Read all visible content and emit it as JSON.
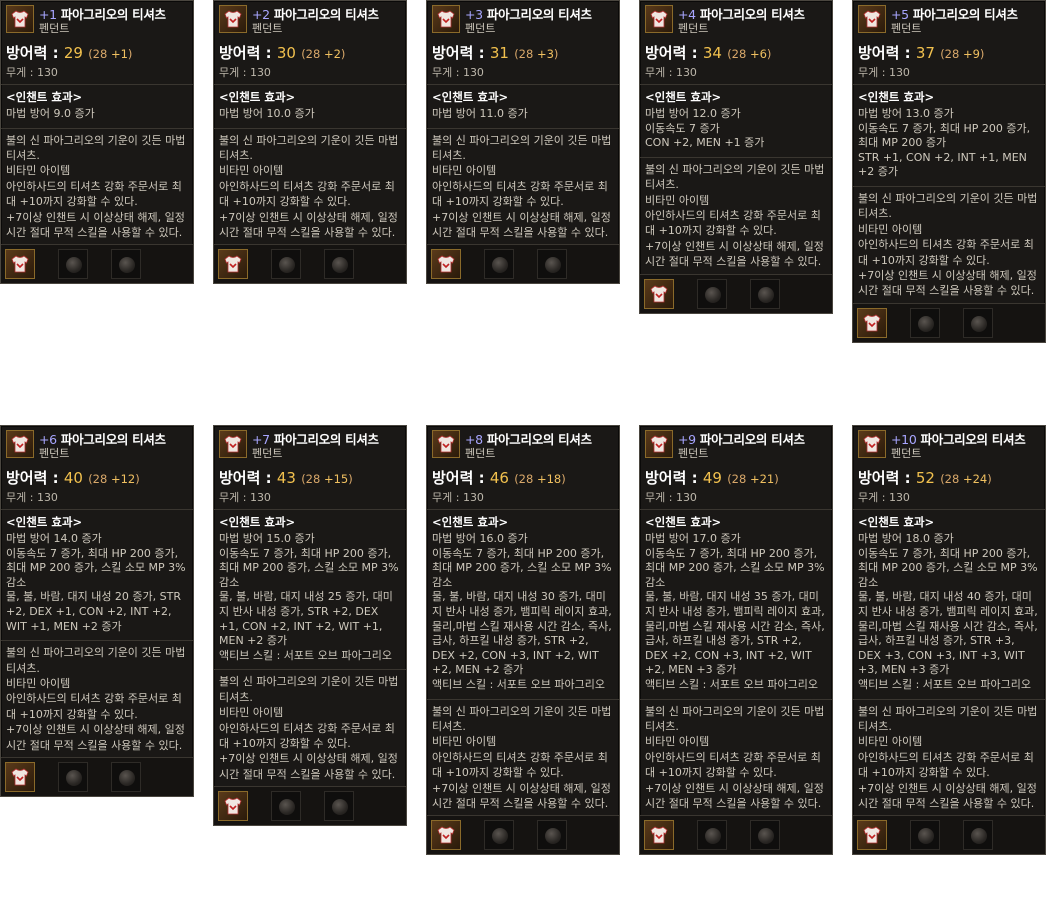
{
  "tooltips": [
    {
      "level": "+1",
      "name": "파아그리오의 티셔츠",
      "type": "펜던트",
      "def_label": "방어력 :",
      "def": "29",
      "def_breakdown_open": "(28",
      "def_bonus": "+1",
      "def_breakdown_close": ")",
      "weight": "무게 : 130",
      "enchant_title": "<인챈트 효과>",
      "effects": "마법 방어 9.0 증가",
      "desc": "불의 신 파아그리오의 기운이 깃든 마법 티셔츠.\n비타민 아이템\n아인하사드의 티셔츠 강화 주문서로 최대 +10까지 강화할 수 있다.\n+7이상 인챈트 시 이상상태 해제, 일정 시간 절대 무적 스킬을 사용할 수 있다."
    },
    {
      "level": "+2",
      "name": "파아그리오의 티셔츠",
      "type": "펜던트",
      "def_label": "방어력 :",
      "def": "30",
      "def_breakdown_open": "(28",
      "def_bonus": "+2",
      "def_breakdown_close": ")",
      "weight": "무게 : 130",
      "enchant_title": "<인챈트 효과>",
      "effects": "마법 방어 10.0 증가",
      "desc": "불의 신 파아그리오의 기운이 깃든 마법 티셔츠.\n비타민 아이템\n아인하사드의 티셔츠 강화 주문서로 최대 +10까지 강화할 수 있다.\n+7이상 인챈트 시 이상상태 해제, 일정 시간 절대 무적 스킬을 사용할 수 있다."
    },
    {
      "level": "+3",
      "name": "파아그리오의 티셔츠",
      "type": "펜던트",
      "def_label": "방어력 :",
      "def": "31",
      "def_breakdown_open": "(28",
      "def_bonus": "+3",
      "def_breakdown_close": ")",
      "weight": "무게 : 130",
      "enchant_title": "<인챈트 효과>",
      "effects": "마법 방어 11.0 증가",
      "desc": "불의 신 파아그리오의 기운이 깃든 마법 티셔츠.\n비타민 아이템\n아인하사드의 티셔츠 강화 주문서로 최대 +10까지 강화할 수 있다.\n+7이상 인챈트 시 이상상태 해제, 일정 시간 절대 무적 스킬을 사용할 수 있다."
    },
    {
      "level": "+4",
      "name": "파아그리오의 티셔츠",
      "type": "펜던트",
      "def_label": "방어력 :",
      "def": "34",
      "def_breakdown_open": "(28",
      "def_bonus": "+6",
      "def_breakdown_close": ")",
      "weight": "무게 : 130",
      "enchant_title": "<인챈트 효과>",
      "effects": "마법 방어 12.0 증가\n이동속도 7 증가\nCON +2, MEN +1 증가",
      "desc": "불의 신 파아그리오의 기운이 깃든 마법 티셔츠.\n비타민 아이템\n아인하사드의 티셔츠 강화 주문서로 최대 +10까지 강화할 수 있다.\n+7이상 인챈트 시 이상상태 해제, 일정 시간 절대 무적 스킬을 사용할 수 있다."
    },
    {
      "level": "+5",
      "name": "파아그리오의 티셔츠",
      "type": "펜던트",
      "def_label": "방어력 :",
      "def": "37",
      "def_breakdown_open": "(28",
      "def_bonus": "+9",
      "def_breakdown_close": ")",
      "weight": "무게 : 130",
      "enchant_title": "<인챈트 효과>",
      "effects": "마법 방어 13.0 증가\n이동속도 7 증가, 최대 HP 200 증가, 최대 MP 200 증가\nSTR +1, CON +2, INT +1, MEN +2 증가",
      "desc": "불의 신 파아그리오의 기운이 깃든 마법 티셔츠.\n비타민 아이템\n아인하사드의 티셔츠 강화 주문서로 최대 +10까지 강화할 수 있다.\n+7이상 인챈트 시 이상상태 해제, 일정 시간 절대 무적 스킬을 사용할 수 있다."
    },
    {
      "level": "+6",
      "name": "파아그리오의 티셔츠",
      "type": "펜던트",
      "def_label": "방어력 :",
      "def": "40",
      "def_breakdown_open": "(28",
      "def_bonus": "+12",
      "def_breakdown_close": ")",
      "weight": "무게 : 130",
      "enchant_title": "<인챈트 효과>",
      "effects": "마법 방어 14.0 증가\n이동속도 7 증가, 최대 HP 200 증가, 최대 MP 200 증가, 스킬 소모 MP 3% 감소\n물, 불, 바람, 대지 내성 20 증가, STR +2, DEX +1, CON +2, INT +2, WIT +1, MEN +2 증가",
      "desc": "불의 신 파아그리오의 기운이 깃든 마법 티셔츠.\n비타민 아이템\n아인하사드의 티셔츠 강화 주문서로 최대 +10까지 강화할 수 있다.\n+7이상 인챈트 시 이상상태 해제, 일정 시간 절대 무적 스킬을 사용할 수 있다."
    },
    {
      "level": "+7",
      "name": "파아그리오의 티셔츠",
      "type": "펜던트",
      "def_label": "방어력 :",
      "def": "43",
      "def_breakdown_open": "(28",
      "def_bonus": "+15",
      "def_breakdown_close": ")",
      "weight": "무게 : 130",
      "enchant_title": "<인챈트 효과>",
      "effects": "마법 방어 15.0 증가\n이동속도 7 증가, 최대 HP 200 증가, 최대 MP 200 증가, 스킬 소모 MP 3% 감소\n물, 불, 바람, 대지 내성 25 증가, 대미지 반사 내성 증가, STR +2, DEX +1, CON +2, INT +2, WIT +1, MEN +2 증가\n액티브 스킬 : 서포트 오브 파아그리오",
      "desc": "불의 신 파아그리오의 기운이 깃든 마법 티셔츠.\n비타민 아이템\n아인하사드의 티셔츠 강화 주문서로 최대 +10까지 강화할 수 있다.\n+7이상 인챈트 시 이상상태 해제, 일정 시간 절대 무적 스킬을 사용할 수 있다."
    },
    {
      "level": "+8",
      "name": "파아그리오의 티셔츠",
      "type": "펜던트",
      "def_label": "방어력 :",
      "def": "46",
      "def_breakdown_open": "(28",
      "def_bonus": "+18",
      "def_breakdown_close": ")",
      "weight": "무게 : 130",
      "enchant_title": "<인챈트 효과>",
      "effects": "마법 방어 16.0 증가\n이동속도 7 증가, 최대 HP 200 증가, 최대 MP 200 증가, 스킬 소모 MP 3% 감소\n물, 불, 바람, 대지 내성 30 증가, 대미지 반사 내성 증가, 뱀피릭 레이지 효과, 물리,마법 스킬 재사용 시간 감소, 즉사, 급사, 하프킬 내성 증가, STR +2, DEX +2, CON +3, INT +2, WIT +2, MEN +2 증가\n액티브 스킬 : 서포트 오브 파아그리오",
      "desc": "불의 신 파아그리오의 기운이 깃든 마법 티셔츠.\n비타민 아이템\n아인하사드의 티셔츠 강화 주문서로 최대 +10까지 강화할 수 있다.\n+7이상 인챈트 시 이상상태 해제, 일정 시간 절대 무적 스킬을 사용할 수 있다."
    },
    {
      "level": "+9",
      "name": "파아그리오의 티셔츠",
      "type": "펜던트",
      "def_label": "방어력 :",
      "def": "49",
      "def_breakdown_open": "(28",
      "def_bonus": "+21",
      "def_breakdown_close": ")",
      "weight": "무게 : 130",
      "enchant_title": "<인챈트 효과>",
      "effects": "마법 방어 17.0 증가\n이동속도 7 증가, 최대 HP 200 증가, 최대 MP 200 증가, 스킬 소모 MP 3% 감소\n물, 불, 바람, 대지 내성 35 증가, 대미지 반사 내성 증가, 뱀피릭 레이지 효과, 물리,마법 스킬 재사용 시간 감소, 즉사, 급사, 하프킬 내성 증가, STR +2, DEX +2, CON +3, INT +2, WIT +2, MEN +3 증가\n액티브 스킬 : 서포트 오브 파아그리오",
      "desc": "불의 신 파아그리오의 기운이 깃든 마법 티셔츠.\n비타민 아이템\n아인하사드의 티셔츠 강화 주문서로 최대 +10까지 강화할 수 있다.\n+7이상 인챈트 시 이상상태 해제, 일정 시간 절대 무적 스킬을 사용할 수 있다."
    },
    {
      "level": "+10",
      "name": "파아그리오의 티셔츠",
      "type": "펜던트",
      "def_label": "방어력 :",
      "def": "52",
      "def_breakdown_open": "(28",
      "def_bonus": "+24",
      "def_breakdown_close": ")",
      "weight": "무게 : 130",
      "enchant_title": "<인챈트 효과>",
      "effects": "마법 방어 18.0 증가\n이동속도 7 증가, 최대 HP 200 증가, 최대 MP 200 증가, 스킬 소모 MP 3% 감소\n물, 불, 바람, 대지 내성 40 증가, 대미지 반사 내성 증가, 뱀피릭 레이지 효과, 물리,마법 스킬 재사용 시간 감소, 즉사, 급사, 하프킬 내성 증가, STR +3, DEX +3, CON +3, INT +3, WIT +3, MEN +3 증가\n액티브 스킬 : 서포트 오브 파아그리오",
      "desc": "불의 신 파아그리오의 기운이 깃든 마법 티셔츠.\n비타민 아이템\n아인하사드의 티셔츠 강화 주문서로 최대 +10까지 강화할 수 있다.\n+7이상 인챈트 시 이상상태 해제, 일정 시간 절대 무적 스킬을 사용할 수 있다."
    }
  ]
}
